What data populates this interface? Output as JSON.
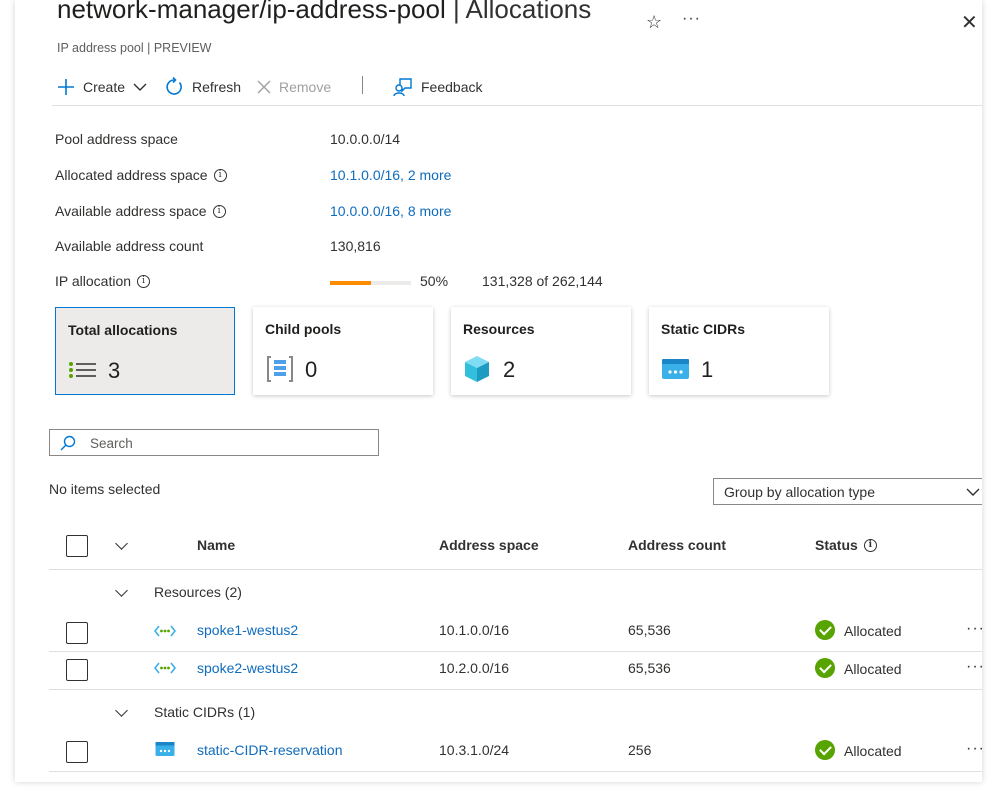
{
  "header": {
    "title_main": "network-manager/ip-address-pool",
    "title_separator": " | ",
    "title_section": "Allocations",
    "subtitle": "IP address pool | PREVIEW",
    "star_glyph": "☆",
    "more_glyph": "···",
    "close_glyph": "✕"
  },
  "toolbar": {
    "create_label": "Create",
    "refresh_label": "Refresh",
    "remove_label": "Remove",
    "feedback_label": "Feedback"
  },
  "properties": {
    "pool_address_space_label": "Pool address space",
    "pool_address_space_value": "10.0.0.0/14",
    "allocated_address_space_label": "Allocated address space",
    "allocated_address_space_value": "10.1.0.0/16, 2 more",
    "available_address_space_label": "Available address space",
    "available_address_space_value": "10.0.0.0/16, 8 more",
    "available_address_count_label": "Available address count",
    "available_address_count_value": "130,816",
    "ip_allocation_label": "IP allocation",
    "ip_allocation_percent": "50%",
    "ip_allocation_fraction": 0.5,
    "ip_allocation_detail": "131,328 of 262,144"
  },
  "cards": [
    {
      "title": "Total allocations",
      "value": "3",
      "icon": "list-icon"
    },
    {
      "title": "Child pools",
      "value": "0",
      "icon": "child-pool-icon"
    },
    {
      "title": "Resources",
      "value": "2",
      "icon": "cube-icon"
    },
    {
      "title": "Static CIDRs",
      "value": "1",
      "icon": "static-cidr-icon"
    }
  ],
  "search": {
    "placeholder": "Search"
  },
  "selection_text": "No items selected",
  "group_by": {
    "selected": "Group by allocation type"
  },
  "table": {
    "columns": [
      "Name",
      "Address space",
      "Address count",
      "Status"
    ],
    "groups": [
      {
        "label": "Resources (2)",
        "rows": [
          {
            "name": "spoke1-westus2",
            "address_space": "10.1.0.0/16",
            "address_count": "65,536",
            "status": "Allocated",
            "icon": "vnet-icon"
          },
          {
            "name": "spoke2-westus2",
            "address_space": "10.2.0.0/16",
            "address_count": "65,536",
            "status": "Allocated",
            "icon": "vnet-icon"
          }
        ]
      },
      {
        "label": "Static CIDRs (1)",
        "rows": [
          {
            "name": "static-CIDR-reservation",
            "address_space": "10.3.1.0/24",
            "address_count": "256",
            "status": "Allocated",
            "icon": "static-cidr-icon"
          }
        ]
      }
    ]
  },
  "colors": {
    "accent": "#0078d4",
    "link": "#0f6cbd",
    "progress": "#ff8c00",
    "status_ok": "#57a300"
  }
}
